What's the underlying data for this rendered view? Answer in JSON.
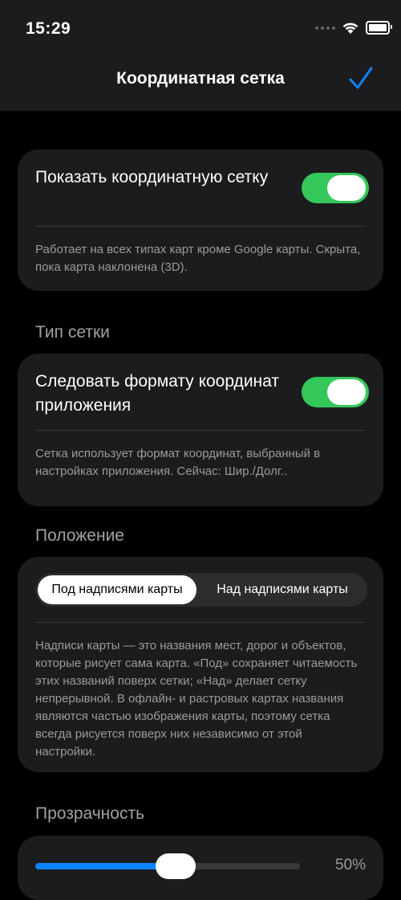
{
  "status": {
    "time": "15:29"
  },
  "nav": {
    "title": "Координатная сетка"
  },
  "grid_toggle": {
    "label": "Показать координатную сетку",
    "on": true,
    "footnote": "Работает на всех типах карт кроме Google карты. Скрыта, пока карта наклонена (3D)."
  },
  "grid_type": {
    "header": "Тип сетки",
    "label": "Следовать формату координат приложения",
    "on": true,
    "footnote": "Сетка использует формат координат, выбранный в настройках приложения. Сейчас: Шир./Долг.."
  },
  "position": {
    "header": "Положение",
    "options": [
      "Под надписями карты",
      "Над надписями карты"
    ],
    "selected": "Под надписями карты",
    "footnote": "Надписи карты — это названия мест, дорог и объектов, которые рисует сама карта. «Под» сохраняет читаемость этих названий поверх сетки; «Над» делает сетку непрерывной. В офлайн- и растровых картах названия являются частью изображения карты, поэтому сетка всегда рисуется поверх них независимо от этой настройки."
  },
  "opacity": {
    "header": "Прозрачность",
    "value_label": "50%",
    "value": 0.5
  },
  "colors": {
    "toggle_on": "#34c759",
    "accent": "#0a84ff"
  }
}
